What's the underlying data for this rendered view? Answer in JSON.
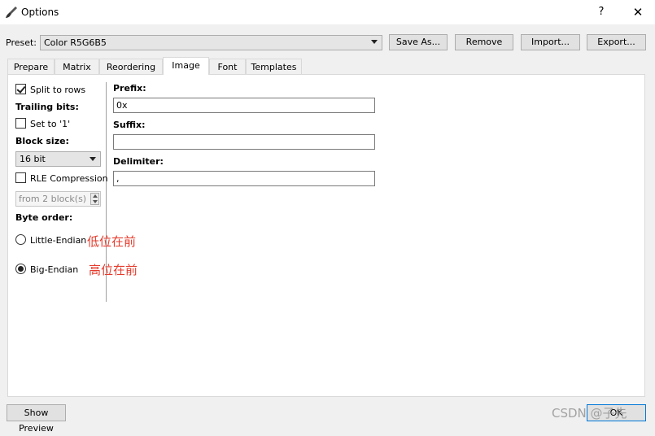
{
  "window": {
    "title": "Options",
    "help_label": "?",
    "close_label": "✕"
  },
  "preset": {
    "label": "Preset:",
    "value": "Color R5G6B5"
  },
  "preset_buttons": {
    "save_as": "Save As...",
    "remove": "Remove",
    "import": "Import...",
    "export": "Export..."
  },
  "tabs": [
    "Prepare",
    "Matrix",
    "Reordering",
    "Image",
    "Font",
    "Templates"
  ],
  "active_tab": "Image",
  "image": {
    "split_to_rows": {
      "label": "Split to rows",
      "checked": true
    },
    "trailing_bits": {
      "heading": "Trailing bits:",
      "set_to_1": {
        "label": "Set to '1'",
        "checked": false
      }
    },
    "block_size": {
      "heading": "Block size:",
      "value": "16 bit"
    },
    "rle_compression": {
      "label": "RLE Compression",
      "checked": false
    },
    "rle_min_blocks": {
      "value": "from 2 block(s)"
    },
    "byte_order": {
      "heading": "Byte order:",
      "options": [
        {
          "label": "Little-Endian",
          "selected": false,
          "annotation": "低位在前"
        },
        {
          "label": "Big-Endian",
          "selected": true,
          "annotation": "高位在前"
        }
      ]
    },
    "prefix": {
      "label": "Prefix:",
      "value": "0x"
    },
    "suffix": {
      "label": "Suffix:",
      "value": ""
    },
    "delimiter": {
      "label": "Delimiter:",
      "value": ", "
    }
  },
  "footer": {
    "show_preview": "Show Preview",
    "ok": "OK"
  },
  "watermark": "CSDN @子先"
}
